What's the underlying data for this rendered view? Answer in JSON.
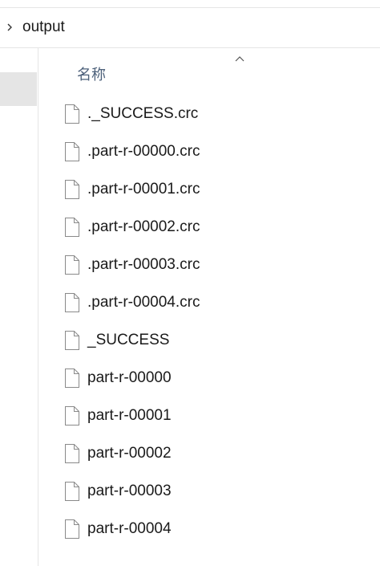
{
  "address_bar": {
    "path": "output"
  },
  "file_list": {
    "column_header": "名称",
    "sort_direction": "ascending",
    "items": [
      {
        "name": "._SUCCESS.crc"
      },
      {
        "name": ".part-r-00000.crc"
      },
      {
        "name": ".part-r-00001.crc"
      },
      {
        "name": ".part-r-00002.crc"
      },
      {
        "name": ".part-r-00003.crc"
      },
      {
        "name": ".part-r-00004.crc"
      },
      {
        "name": "_SUCCESS"
      },
      {
        "name": "part-r-00000"
      },
      {
        "name": "part-r-00001"
      },
      {
        "name": "part-r-00002"
      },
      {
        "name": "part-r-00003"
      },
      {
        "name": "part-r-00004"
      }
    ]
  },
  "icons": {
    "breadcrumb_chevron": "chevron-right-icon",
    "sort_indicator": "chevron-up-icon",
    "file": "file-icon"
  },
  "colors": {
    "header_text": "#4c607a",
    "selected_nav": "#e5e5e5"
  }
}
